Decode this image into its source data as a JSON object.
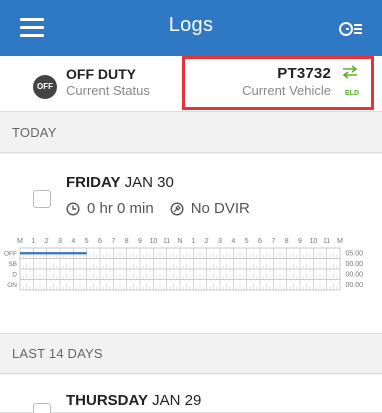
{
  "appbar": {
    "title": "Logs",
    "menu_icon": "hamburger-menu-icon",
    "settings_icon": "filter-settings-icon"
  },
  "status": {
    "badge": "OFF",
    "duty": "OFF DUTY",
    "duty_sub": "Current Status"
  },
  "vehicle": {
    "id": "PT3732",
    "sub": "Current Vehicle",
    "eld": "ELD",
    "icon": "swap-arrows-icon",
    "accent": "#5bb02b",
    "highlight": "#e3343a"
  },
  "sections": {
    "today": "TODAY",
    "last14": "LAST 14 DAYS"
  },
  "today": {
    "day_bold": "FRIDAY",
    "date": "JAN 30",
    "hours": "0 hr 0 min",
    "dvir": "No DVIR",
    "grid": {
      "hour_labels": [
        "M",
        "1",
        "2",
        "3",
        "4",
        "5",
        "6",
        "7",
        "8",
        "9",
        "10",
        "11",
        "N",
        "1",
        "2",
        "3",
        "4",
        "5",
        "6",
        "7",
        "8",
        "9",
        "10",
        "11",
        "M"
      ],
      "rows": [
        {
          "label": "OFF",
          "total": "05.00",
          "active_hours": [
            0,
            5
          ]
        },
        {
          "label": "SB",
          "total": "00.00"
        },
        {
          "label": "D",
          "total": "00.00"
        },
        {
          "label": "ON",
          "total": "00.00"
        }
      ],
      "line_color": "#2f78c4"
    }
  },
  "thursday": {
    "day_bold": "THURSDAY",
    "date": "JAN 29"
  },
  "colors": {
    "appbar": "#2f78c4"
  }
}
